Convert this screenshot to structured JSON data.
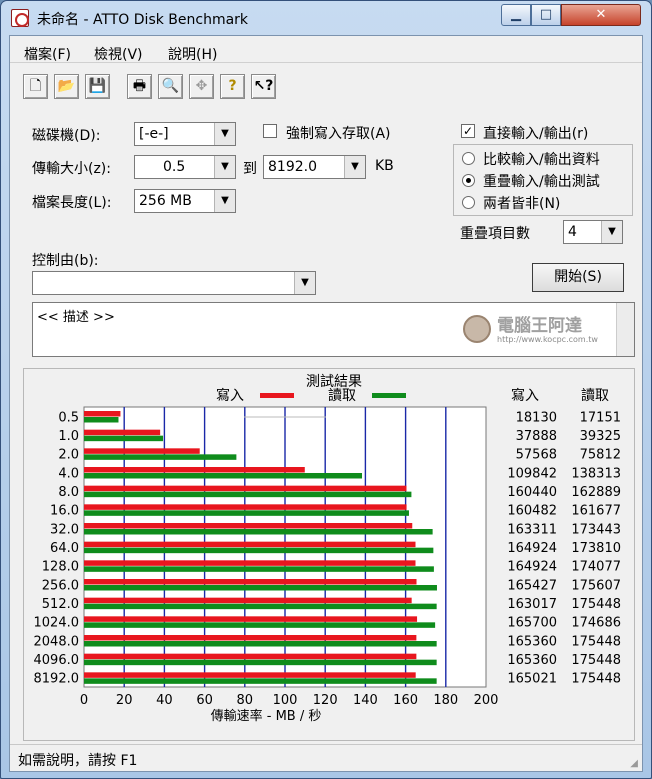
{
  "window": {
    "title": "未命名 - ATTO Disk Benchmark",
    "min_glyph": "▁",
    "max_glyph": "□",
    "close_glyph": "✕"
  },
  "menu": [
    "檔案(F)",
    "檢視(V)",
    "說明(H)"
  ],
  "toolbar_glyphs": {
    "new": "🗋",
    "open": "📂",
    "save": "💾",
    "print": "🖶",
    "preview": "🔍",
    "move": "✥",
    "help": "?",
    "context_help": "↖?"
  },
  "form": {
    "drive_label": "磁碟機(D):",
    "drive_value": "[-e-]",
    "force_write_label": "強制寫入存取(A)",
    "transfer_label": "傳輸大小(z):",
    "transfer_from": "0.5",
    "to_label": "到",
    "transfer_to": "8192.0",
    "kb_label": "KB",
    "length_label": "檔案長度(L):",
    "length_value": "256 MB",
    "direct_io_label": "直接輸入/輸出(r)",
    "direct_io_checked": "✓",
    "radio_compare": "比較輸入/輸出資料",
    "radio_overlap": "重疊輸入/輸出測試",
    "radio_neither": "兩者皆非(N)",
    "queue_label": "重疊項目數",
    "queue_value": "4",
    "control_label": "控制由(b):",
    "control_value": "",
    "start_button": "開始(S)",
    "description": "<< 描述 >>",
    "watermark_main": "電腦王阿達",
    "watermark_url": "http://www.kocpc.com.tw"
  },
  "chart_data": {
    "type": "bar",
    "title": "測試結果",
    "legend_write": "寫入",
    "legend_read": "讀取",
    "col_write": "寫入",
    "col_read": "讀取",
    "xlabel": "傳輸速率 - MB / 秒",
    "xlim": [
      0,
      200
    ],
    "xticks": [
      0,
      20,
      40,
      60,
      80,
      100,
      120,
      140,
      160,
      180,
      200
    ],
    "categories": [
      "0.5",
      "1.0",
      "2.0",
      "4.0",
      "8.0",
      "16.0",
      "32.0",
      "64.0",
      "128.0",
      "256.0",
      "512.0",
      "1024.0",
      "2048.0",
      "4096.0",
      "8192.0"
    ],
    "series": [
      {
        "name": "寫入",
        "color": "#e8161e",
        "values": [
          18130,
          37888,
          57568,
          109842,
          160440,
          160482,
          163311,
          164924,
          164924,
          165427,
          163017,
          165700,
          165360,
          165360,
          165021
        ]
      },
      {
        "name": "讀取",
        "color": "#0f8c1c",
        "values": [
          17151,
          39325,
          75812,
          138313,
          162889,
          161677,
          173443,
          173810,
          174077,
          175607,
          175448,
          174686,
          175448,
          175448,
          175448
        ]
      }
    ]
  },
  "status": {
    "text": "如需說明，請按 F1"
  }
}
